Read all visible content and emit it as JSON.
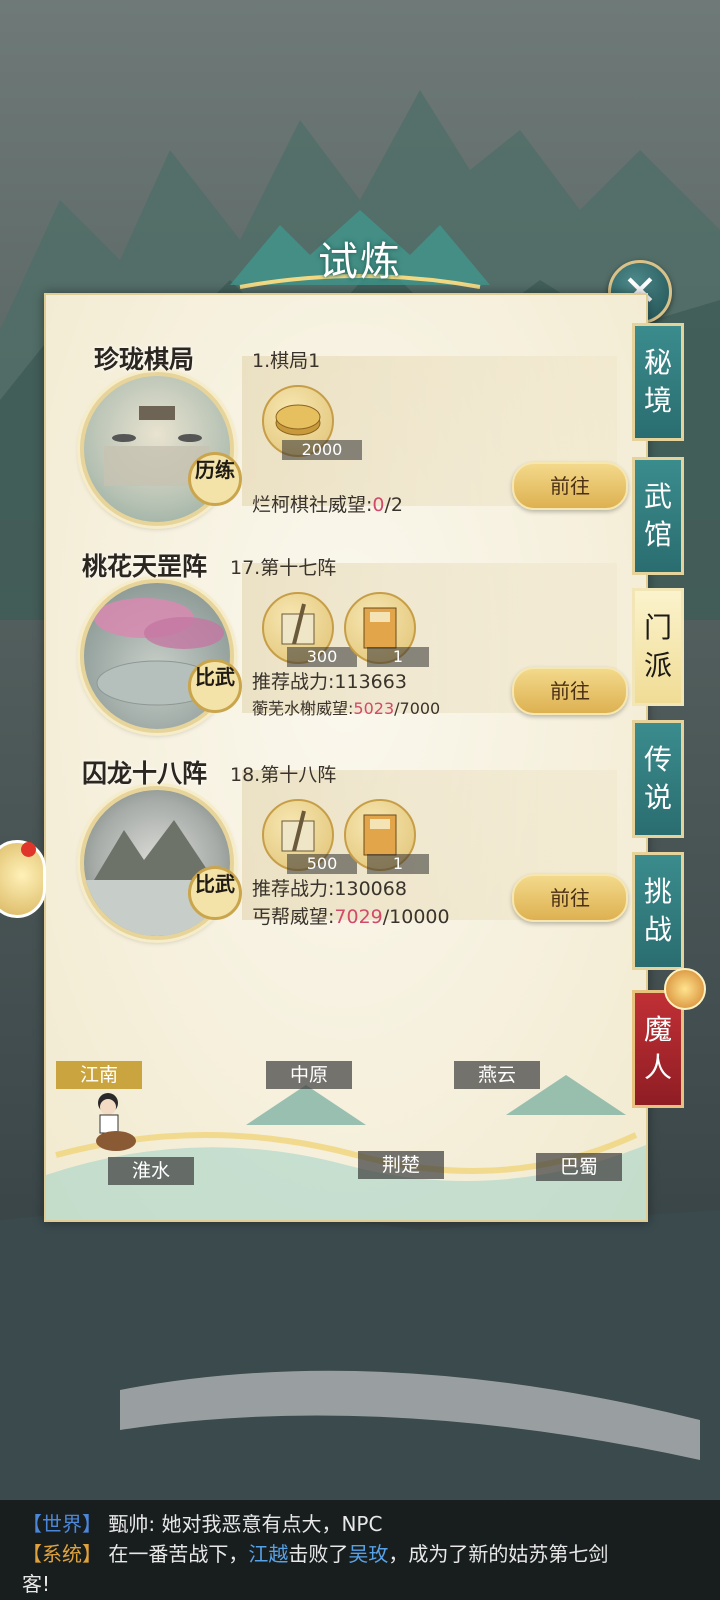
{
  "title": "试炼",
  "close_label": "✕",
  "cards": [
    {
      "name": "珍珑棋局",
      "subtitle": "1.棋局1",
      "seal": "历练",
      "items": [
        {
          "icon": "coin-icon",
          "qty": "2000"
        }
      ],
      "power": "",
      "reputation_label": "烂柯棋社威望:",
      "reputation_current": "0",
      "reputation_total": "/2",
      "button": "前往"
    },
    {
      "name": "桃花天罡阵",
      "subtitle": "17.第十七阵",
      "seal": "比武",
      "items": [
        {
          "icon": "scroll-icon",
          "qty": "300"
        },
        {
          "icon": "book-icon",
          "qty": "1"
        }
      ],
      "power": "推荐战力:113663",
      "reputation_label": "蘅芜水榭威望:",
      "reputation_current": "5023",
      "reputation_total": "/7000",
      "button": "前往"
    },
    {
      "name": "囚龙十八阵",
      "subtitle": "18.第十八阵",
      "seal": "比武",
      "items": [
        {
          "icon": "scroll-icon",
          "qty": "500"
        },
        {
          "icon": "book-icon",
          "qty": "1"
        }
      ],
      "power": "推荐战力:130068",
      "reputation_label": "丐帮威望:",
      "reputation_current": "7029",
      "reputation_total": "/10000",
      "button": "前往"
    }
  ],
  "regions": [
    "江南",
    "中原",
    "燕云",
    "淮水",
    "荆楚",
    "巴蜀"
  ],
  "active_region": "江南",
  "side_tabs": [
    "秘境",
    "武馆",
    "门派",
    "传说",
    "挑战",
    "魔人"
  ],
  "active_tab": "门派",
  "chat": {
    "line1_tag": "【世界】",
    "line1_text": " 甄帅: 她对我恶意有点大，NPC",
    "line2_tag": "【系统】",
    "line2_pre": " 在一番苦战下，",
    "line2_name1": "江越",
    "line2_mid": "击败了",
    "line2_name2": "吴玫",
    "line2_post": "，成为了新的姑苏第七剑",
    "line3_text": "客!"
  },
  "colors": {
    "accent_teal": "#2a6d70",
    "gold": "#ddb151",
    "reputation_value": "#d24a6a",
    "demon_red": "#c03035"
  }
}
